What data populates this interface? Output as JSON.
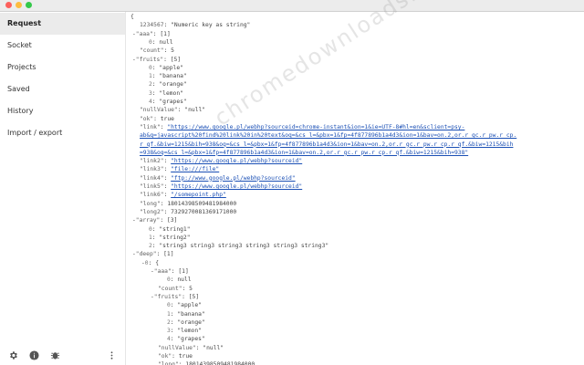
{
  "sidebar": {
    "items": [
      {
        "label": "Request",
        "active": true
      },
      {
        "label": "Socket"
      },
      {
        "label": "Projects"
      },
      {
        "label": "Saved"
      },
      {
        "label": "History"
      },
      {
        "label": "Import / export"
      }
    ],
    "footer_icons": [
      "gear-icon",
      "info-icon",
      "bug-icon",
      "more-vertical-icon"
    ]
  },
  "json": {
    "lines": [
      {
        "t": "plain",
        "text": "{",
        "indent": 0
      },
      {
        "t": "kv",
        "key": "1234567",
        "val": "\"Numeric key as string\"",
        "indent": 1
      },
      {
        "t": "kv",
        "tog": "-",
        "key": "\"aaa\"",
        "val": "[1]",
        "indent": 0.2
      },
      {
        "t": "kv",
        "key": "0",
        "val": "null",
        "indent": 2,
        "idx": true
      },
      {
        "t": "kv",
        "key": "\"count\"",
        "val": "5",
        "indent": 1
      },
      {
        "t": "kv",
        "tog": "-",
        "key": "\"fruits\"",
        "val": "[5]",
        "indent": 0.2
      },
      {
        "t": "kv",
        "key": "0",
        "val": "\"apple\"",
        "indent": 2,
        "idx": true
      },
      {
        "t": "kv",
        "key": "1",
        "val": "\"banana\"",
        "indent": 2,
        "idx": true
      },
      {
        "t": "kv",
        "key": "2",
        "val": "\"orange\"",
        "indent": 2,
        "idx": true
      },
      {
        "t": "kv",
        "key": "3",
        "val": "\"lemon\"",
        "indent": 2,
        "idx": true
      },
      {
        "t": "kv",
        "key": "4",
        "val": "\"grapes\"",
        "indent": 2,
        "idx": true
      },
      {
        "t": "kv",
        "key": "\"nullValue\"",
        "val": "\"null\"",
        "indent": 1
      },
      {
        "t": "kv",
        "key": "\"ok\"",
        "val": "true",
        "indent": 1
      },
      {
        "t": "link",
        "key": "\"link\"",
        "val": "\"https://www.google.pl/webhp?sourceid=chrome-instant&ion=1&ie=UTF-8#hl=en&sclient=psy-",
        "indent": 1
      },
      {
        "t": "cont",
        "val": "ab&q=javascript%20find%20link%20in%20text&oq=&cs_l=&pbx=1&fp=4f877896b1a4d3&ion=1&bav=on.2,or.r_gc.r_pw.r_cp.",
        "indent": 1
      },
      {
        "t": "cont",
        "val": "r_qf.&biw=1215&bih=938&oq=&cs_l=&pbx=1&fp=4f877896b1a4d3&ion=1&bav=on.2,or.r_gc.r_pw.r_cp.r_qf.&biw=1215&bih",
        "indent": 1
      },
      {
        "t": "cont",
        "val": "=938&oq=&cs_l=&pbx=1&fp=4f877896b1a4d3&ion=1&bav=on.2,or.r_gc.r_pw.r_cp.r_qf.&biw=1215&bih=938\"",
        "indent": 1
      },
      {
        "t": "link",
        "key": "\"link2\"",
        "val": "\"https://www.google.pl/webhp?sourceid\"",
        "indent": 1
      },
      {
        "t": "link",
        "key": "\"link3\"",
        "val": "\"file:///file\"",
        "indent": 1
      },
      {
        "t": "link",
        "key": "\"link4\"",
        "val": "\"ftp://www.google.pl/webhp?sourceid\"",
        "indent": 1
      },
      {
        "t": "link",
        "key": "\"link5\"",
        "val": "\"https://www.google.pl/webhp?sourceid\"",
        "indent": 1
      },
      {
        "t": "link",
        "key": "\"link6\"",
        "val": "\"/somepoint.php\"",
        "indent": 1
      },
      {
        "t": "kv",
        "key": "\"long\"",
        "val": "18014398509481984000",
        "indent": 1
      },
      {
        "t": "kv",
        "key": "\"long2\"",
        "val": "7329270081369171000",
        "indent": 1
      },
      {
        "t": "kv",
        "tog": "-",
        "key": "\"array\"",
        "val": "[3]",
        "indent": 0.2
      },
      {
        "t": "kv",
        "key": "0",
        "val": "\"string1\"",
        "indent": 2,
        "idx": true
      },
      {
        "t": "kv",
        "key": "1",
        "val": "\"string2\"",
        "indent": 2,
        "idx": true
      },
      {
        "t": "kv",
        "key": "2",
        "val": "\"string3 string3 string3 string3 string3 string3\"",
        "indent": 2,
        "idx": true
      },
      {
        "t": "kv",
        "tog": "-",
        "key": "\"deep\"",
        "val": "[1]",
        "indent": 0.2
      },
      {
        "t": "kv",
        "tog": "-",
        "key": "0",
        "val": "{",
        "indent": 1.2,
        "idx": true
      },
      {
        "t": "kv",
        "tog": "-",
        "key": "\"aaa\"",
        "val": "[1]",
        "indent": 2.2
      },
      {
        "t": "kv",
        "key": "0",
        "val": "null",
        "indent": 4,
        "idx": true
      },
      {
        "t": "kv",
        "key": "\"count\"",
        "val": "5",
        "indent": 3
      },
      {
        "t": "kv",
        "tog": "-",
        "key": "\"fruits\"",
        "val": "[5]",
        "indent": 2.2
      },
      {
        "t": "kv",
        "key": "0",
        "val": "\"apple\"",
        "indent": 4,
        "idx": true
      },
      {
        "t": "kv",
        "key": "1",
        "val": "\"banana\"",
        "indent": 4,
        "idx": true
      },
      {
        "t": "kv",
        "key": "2",
        "val": "\"orange\"",
        "indent": 4,
        "idx": true
      },
      {
        "t": "kv",
        "key": "3",
        "val": "\"lemon\"",
        "indent": 4,
        "idx": true
      },
      {
        "t": "kv",
        "key": "4",
        "val": "\"grapes\"",
        "indent": 4,
        "idx": true
      },
      {
        "t": "kv",
        "key": "\"nullValue\"",
        "val": "\"null\"",
        "indent": 3
      },
      {
        "t": "kv",
        "key": "\"ok\"",
        "val": "true",
        "indent": 3
      },
      {
        "t": "kv",
        "key": "\"long\"",
        "val": "18014398509481984000",
        "indent": 3
      }
    ]
  },
  "watermark": "chromedownloads.net",
  "colors": {
    "link": "#1a4fb5",
    "active_bg": "#ebebeb"
  }
}
